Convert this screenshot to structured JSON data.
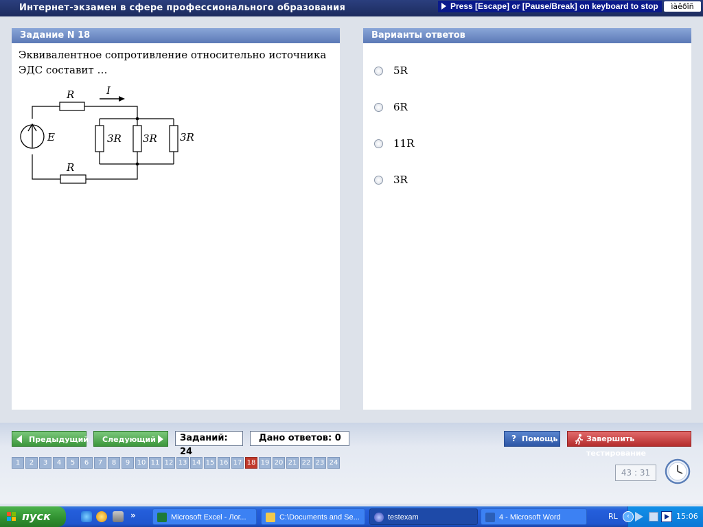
{
  "titlebar": {
    "title": "Интернет-экзамен в сфере профессионального образования",
    "esc_hint": "Press [Escape] or [Pause/Break] on keyboard to stop",
    "lang_indicator": "ìàêðîñ"
  },
  "task_panel": {
    "header": "Задание N 18",
    "question": "Эквивалентное сопротивление относительно источника ЭДС составит …",
    "circuit": {
      "labels": {
        "r_top": "R",
        "current": "I",
        "emf": "E",
        "r_bottom": "R",
        "r_p1": "3R",
        "r_p2": "3R",
        "r_p3": "3R"
      }
    }
  },
  "answer_panel": {
    "header": "Варианты ответов",
    "options": [
      "5R",
      "6R",
      "11R",
      "3R"
    ]
  },
  "nav": {
    "prev_label": "Предыдущий",
    "next_label": "Следующий",
    "tasks_total": "Заданий: 24",
    "answered": "Дано ответов: 0",
    "help_label": "Помощь",
    "finish_label": "Завершить тестирование",
    "pages": [
      "1",
      "2",
      "3",
      "4",
      "5",
      "6",
      "7",
      "8",
      "9",
      "10",
      "11",
      "12",
      "13",
      "14",
      "15",
      "16",
      "17",
      "18",
      "19",
      "20",
      "21",
      "22",
      "23",
      "24"
    ],
    "current_page": "18",
    "timer": "43 : 31"
  },
  "taskbar": {
    "start_label": "пуск",
    "quicklaunch_more": "»",
    "items": [
      {
        "label": "Microsoft Excel - Лог...",
        "icon": "excel-icon",
        "active": false
      },
      {
        "label": "C:\\Documents and Se...",
        "icon": "folder-icon",
        "active": false
      },
      {
        "label": "testexam",
        "icon": "testexam-icon",
        "active": true
      },
      {
        "label": "4 - Microsoft Word",
        "icon": "word-icon",
        "active": false
      }
    ],
    "lang": "RL",
    "time": "15:06"
  },
  "colors": {
    "header_blue": "#5b79b6",
    "green_button": "#3b963b",
    "red_button": "#b42d2d",
    "active_page": "#c0392b",
    "page_button": "#9fb6d6"
  }
}
